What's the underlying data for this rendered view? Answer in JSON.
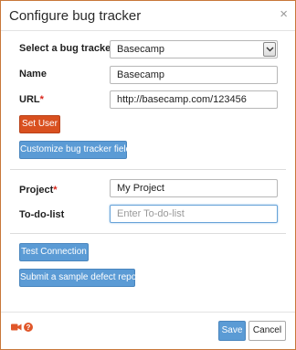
{
  "dialog": {
    "title": "Configure bug tracker",
    "close_glyph": "×"
  },
  "tracker": {
    "label": "Select a bug tracker",
    "selected": "Basecamp"
  },
  "name": {
    "label": "Name",
    "value": "Basecamp"
  },
  "url": {
    "label": "URL",
    "required_mark": "*",
    "value": "http://basecamp.com/123456"
  },
  "buttons": {
    "set_user": "Set User",
    "customize": "Customize bug tracker fields",
    "test_connection": "Test Connection",
    "submit_sample": "Submit a sample defect report",
    "save": "Save",
    "cancel": "Cancel"
  },
  "project": {
    "label": "Project",
    "required_mark": "*",
    "value": "My Project"
  },
  "todo": {
    "label": "To-do-list",
    "placeholder": "Enter To-do-list"
  },
  "footer": {
    "icons": [
      "video-camera-icon",
      "help-icon"
    ]
  },
  "colors": {
    "accent_blue": "#5b9bd5",
    "accent_orange": "#d9501f",
    "dialog_border": "#c8773a",
    "required_red": "#d9261c"
  }
}
